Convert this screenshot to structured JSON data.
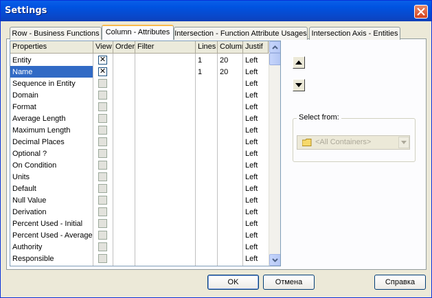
{
  "window": {
    "title": "Settings"
  },
  "tabs": [
    {
      "label": "Row - Business Functions"
    },
    {
      "label": "Column - Attributes"
    },
    {
      "label": "Intersection - Function Attribute Usages"
    },
    {
      "label": "Intersection Axis - Entities"
    }
  ],
  "active_tab": "Column - Attributes",
  "grid": {
    "columns": [
      "Properties",
      "View",
      "Order",
      "Filter",
      "Lines",
      "Column",
      "Justif"
    ],
    "rows": [
      {
        "property": "Entity",
        "view": true,
        "order": "",
        "filter": "",
        "lines": "1",
        "column": "20",
        "justif": "Left"
      },
      {
        "property": "Name",
        "view": true,
        "order": "",
        "filter": "",
        "lines": "1",
        "column": "20",
        "justif": "Left",
        "selected": true
      },
      {
        "property": "Sequence in Entity",
        "view": false,
        "lines": "",
        "column": "",
        "justif": "Left"
      },
      {
        "property": "Domain",
        "view": false,
        "lines": "",
        "column": "",
        "justif": "Left"
      },
      {
        "property": "Format",
        "view": false,
        "lines": "",
        "column": "",
        "justif": "Left"
      },
      {
        "property": "Average Length",
        "view": false,
        "lines": "",
        "column": "",
        "justif": "Left"
      },
      {
        "property": "Maximum Length",
        "view": false,
        "lines": "",
        "column": "",
        "justif": "Left"
      },
      {
        "property": "Decimal Places",
        "view": false,
        "lines": "",
        "column": "",
        "justif": "Left"
      },
      {
        "property": "Optional ?",
        "view": false,
        "lines": "",
        "column": "",
        "justif": "Left"
      },
      {
        "property": "On Condition",
        "view": false,
        "lines": "",
        "column": "",
        "justif": "Left"
      },
      {
        "property": "Units",
        "view": false,
        "lines": "",
        "column": "",
        "justif": "Left"
      },
      {
        "property": "Default",
        "view": false,
        "lines": "",
        "column": "",
        "justif": "Left"
      },
      {
        "property": "Null Value",
        "view": false,
        "lines": "",
        "column": "",
        "justif": "Left"
      },
      {
        "property": "Derivation",
        "view": false,
        "lines": "",
        "column": "",
        "justif": "Left"
      },
      {
        "property": "Percent Used - Initial",
        "view": false,
        "lines": "",
        "column": "",
        "justif": "Left"
      },
      {
        "property": "Percent Used - Average",
        "view": false,
        "lines": "",
        "column": "",
        "justif": "Left"
      },
      {
        "property": "Authority",
        "view": false,
        "lines": "",
        "column": "",
        "justif": "Left"
      },
      {
        "property": "Responsible",
        "view": false,
        "lines": "",
        "column": "",
        "justif": "Left"
      }
    ]
  },
  "select_from": {
    "label": "Select from:",
    "value": "<All Containers>",
    "icon": "folder-icon"
  },
  "buttons": {
    "ok": "OK",
    "cancel": "Отмена",
    "help": "Справка"
  },
  "colors": {
    "titlebar": "#0a5fe8",
    "selection": "#316ac5",
    "face": "#ece9d8"
  }
}
